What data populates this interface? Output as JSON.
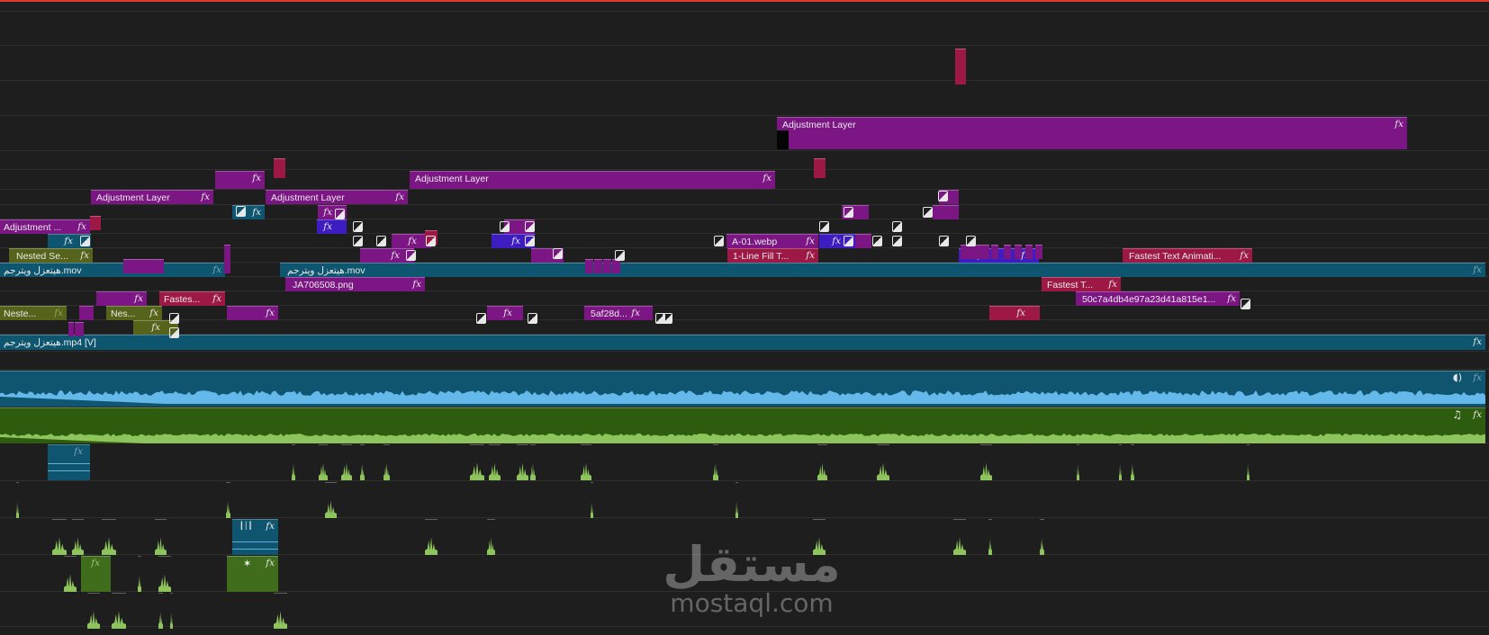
{
  "timeline": {
    "clips": [
      {
        "label": "Adjustment Layer",
        "fx": "fx",
        "color": "purple"
      },
      {
        "label": "Adjustment Layer",
        "fx": "fx",
        "color": "purple"
      },
      {
        "label": "Adjustment Layer",
        "fx": "fx",
        "color": "purple"
      },
      {
        "label": "Adjustment Layer",
        "fx": "fx",
        "color": "purple"
      },
      {
        "label": "Adjustment ...",
        "fx": "fx",
        "color": "purple"
      },
      {
        "label": "A-01.webp",
        "fx": "fx",
        "color": "purple"
      },
      {
        "label": "Nested Se...",
        "fx": "fx",
        "color": "olive"
      },
      {
        "label": "1-Line Fill T...",
        "fx": "fx",
        "color": "crimson"
      },
      {
        "label": "Fastest Text Animati...",
        "fx": "fx",
        "color": "crimson"
      },
      {
        "label": "هيتعزل ويترجم.mov",
        "fx": "fx",
        "color": "teal"
      },
      {
        "label": "هيتعزل ويترجم.mov",
        "fx": "fx",
        "color": "teal"
      },
      {
        "label": "JA706508.png",
        "fx": "fx",
        "color": "purple"
      },
      {
        "label": "Fastest T...",
        "fx": "fx",
        "color": "crimson"
      },
      {
        "label": "Fastes...",
        "fx": "fx",
        "color": "crimson"
      },
      {
        "label": "50c7a4db4e97a23d41a815e1...",
        "fx": "fx",
        "color": "purple"
      },
      {
        "label": "Neste...",
        "fx": "fx",
        "color": "olive"
      },
      {
        "label": "Nes...",
        "fx": "fx",
        "color": "olive"
      },
      {
        "label": "5af28d...",
        "fx": "fx",
        "color": "purple"
      },
      {
        "label": "هيتعزل ويترجم.mp4 [V]",
        "fx": "fx",
        "color": "teal"
      }
    ],
    "fx_label": "fx",
    "audio_tracks": [
      {
        "kind": "voice",
        "icon": "voice-icon",
        "icon_glyph": "◖)",
        "fx": "fx"
      },
      {
        "kind": "music",
        "icon": "music-note-icon",
        "icon_glyph": "♫",
        "fx": "fx"
      }
    ],
    "audio_snippets": [
      {
        "icon": "waveform-icon",
        "icon_glyph": "┃│┃",
        "fx": "fx"
      },
      {
        "icon": "sparkle-icon",
        "icon_glyph": "✶",
        "fx": "fx"
      }
    ],
    "colors": {
      "playhead": "#e03a2c",
      "purple": "#7b1684",
      "blue_purple": "#3d1cc1",
      "teal": "#0e566f",
      "crimson": "#9d1844",
      "olive": "#55641a",
      "audio_teal": "#0f5570",
      "audio_green": "#2d5c0f",
      "waveform_blue": "#65b8ea",
      "waveform_green": "#8dc45b"
    }
  },
  "watermark": {
    "arabic": "مستقل",
    "latin": "mostaql.com"
  }
}
